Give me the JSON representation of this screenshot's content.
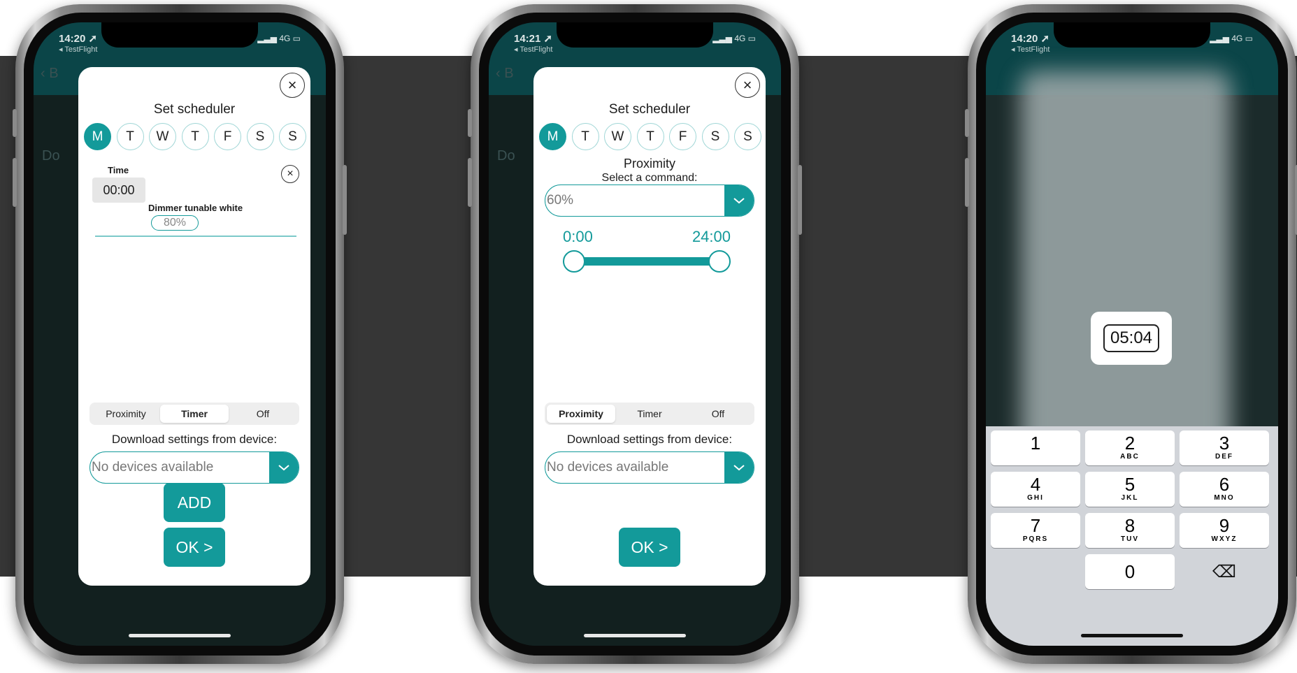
{
  "phone1": {
    "status": {
      "time": "14:20 ➚",
      "back_app": "◂ TestFlight",
      "signal": "▂▃▅ 4G ▭"
    },
    "modal": {
      "title": "Set scheduler",
      "days": [
        "M",
        "T",
        "W",
        "T",
        "F",
        "S",
        "S"
      ],
      "timer_row": {
        "time_label": "Time",
        "time_value": "00:00",
        "device_label": "Dimmer tunable white",
        "device_value": "80%"
      },
      "mode_tabs": [
        "Proximity",
        "Timer",
        "Off"
      ],
      "selected_tab": "Timer",
      "download_label": "Download settings from device:",
      "device_select": "No devices available",
      "add_label": "ADD",
      "ok_label": "OK >"
    },
    "background_text": {
      "header_b": "B",
      "row_d": "Do"
    }
  },
  "phone2": {
    "status": {
      "time": "14:21 ➚",
      "back_app": "◂ TestFlight",
      "signal": "▂▃▅ 4G ▭"
    },
    "modal": {
      "title": "Set scheduler",
      "days": [
        "M",
        "T",
        "W",
        "T",
        "F",
        "S",
        "S"
      ],
      "mode_heading": "Proximity",
      "command_label": "Select a command:",
      "command_value": "60%",
      "range_start": "0:00",
      "range_end": "24:00",
      "range_fraction": [
        0.0,
        1.0
      ],
      "mode_tabs": [
        "Proximity",
        "Timer",
        "Off"
      ],
      "selected_tab": "Proximity",
      "download_label": "Download settings from device:",
      "device_select": "No devices available",
      "ok_label": "OK >"
    },
    "background_text": {
      "header_b": "B",
      "row_d": "Do"
    }
  },
  "phone3": {
    "status": {
      "time": "14:20 ➚",
      "back_app": "◂ TestFlight",
      "signal": "▂▃▅ 4G ▭"
    },
    "picker_value": "05:04",
    "keypad": [
      {
        "digit": "1",
        "letters": ""
      },
      {
        "digit": "2",
        "letters": "ABC"
      },
      {
        "digit": "3",
        "letters": "DEF"
      },
      {
        "digit": "4",
        "letters": "GHI"
      },
      {
        "digit": "5",
        "letters": "JKL"
      },
      {
        "digit": "6",
        "letters": "MNO"
      },
      {
        "digit": "7",
        "letters": "PQRS"
      },
      {
        "digit": "8",
        "letters": "TUV"
      },
      {
        "digit": "9",
        "letters": "WXYZ"
      },
      {
        "digit": "0",
        "letters": ""
      }
    ],
    "delete_key": "⌫"
  },
  "colors": {
    "accent": "#139a9a",
    "app_header": "#0b4548",
    "band": "#363636"
  }
}
